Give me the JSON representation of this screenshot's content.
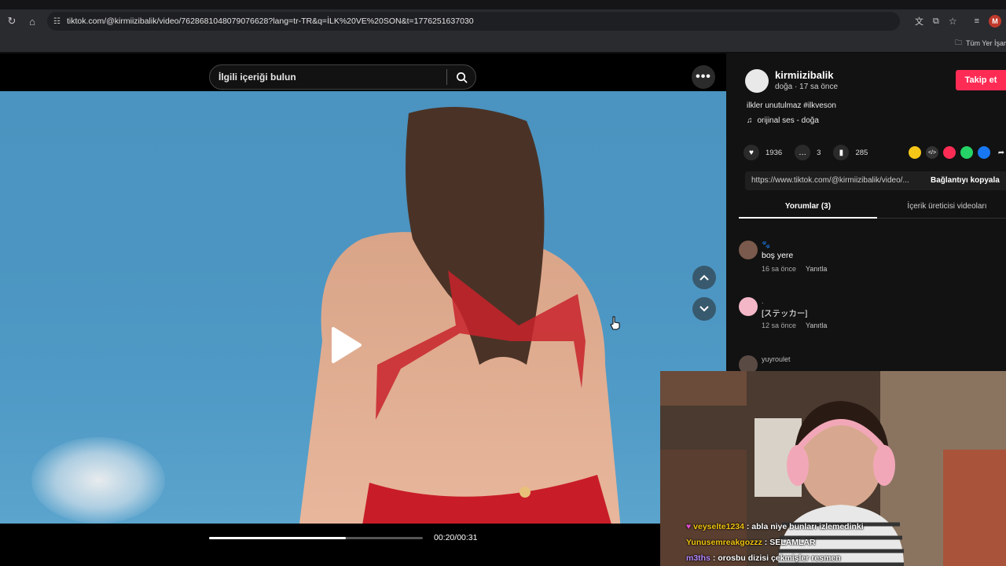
{
  "browser": {
    "url": "tiktok.com/@kirmiizibalik/video/7628681048079076628?lang=tr-TR&q=İLK%20VE%20SON&t=1776251637030",
    "profile_initial": "M",
    "bookmarks_label": "Tüm Yer İşar"
  },
  "search": {
    "placeholder": "İlgili içeriği bulun"
  },
  "player": {
    "current_time": "00:20",
    "duration": "00:31",
    "time_text": "00:20/00:31",
    "progress_fraction": 0.64
  },
  "post": {
    "author": "kirmiizibalik",
    "author_meta": "doğa · 17 sa önce",
    "follow_label": "Takip et",
    "caption": "ilkler unutulmaz #ilkveson",
    "sound": "orijinal ses - doğa",
    "likes": "1936",
    "comments_count": "3",
    "saves": "285",
    "link": "https://www.tiktok.com/@kirmiizibalik/video/...",
    "copy_label": "Bağlantıyı kopyala"
  },
  "tabs": {
    "comments": "Yorumlar (3)",
    "creator_videos": "İçerik üreticisi videoları"
  },
  "comments": [
    {
      "user": "🐾",
      "text": "boş yere",
      "time": "16 sa önce",
      "reply": "Yanıtla"
    },
    {
      "user": ".",
      "text": "[ステッカー]",
      "time": "12 sa önce",
      "reply": "Yanıtla"
    },
    {
      "user": "yuyroulet",
      "text": "",
      "time": "",
      "reply": ""
    }
  ],
  "chat": [
    {
      "user": "veyselte1234",
      "message": " : abla niye bunları izlemedinki",
      "color": "#f1c40f"
    },
    {
      "user": "Yunusemreakgozzz",
      "message": " : SELAMLAR",
      "color": "#f1c40f"
    },
    {
      "user": "m3ths",
      "message": " : orosbu dizisi çekmişler resmen",
      "color": "#b388ff"
    }
  ],
  "colors": {
    "accent": "#fe2c55",
    "chat_text": "#ffffff"
  }
}
